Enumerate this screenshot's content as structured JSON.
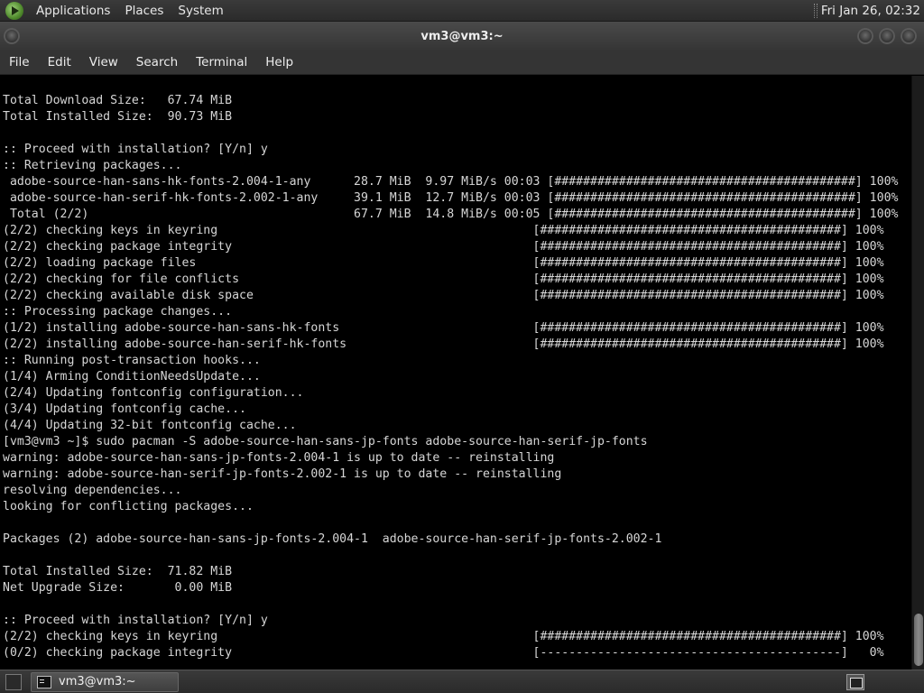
{
  "top_panel": {
    "menus": [
      "Applications",
      "Places",
      "System"
    ],
    "clock": "Fri Jan 26, 02:32"
  },
  "window": {
    "title": "vm3@vm3:~"
  },
  "menubar": {
    "items": [
      "File",
      "Edit",
      "View",
      "Search",
      "Terminal",
      "Help"
    ]
  },
  "terminal": {
    "lines": [
      "Total Download Size:   67.74 MiB",
      "Total Installed Size:  90.73 MiB",
      "",
      ":: Proceed with installation? [Y/n] y",
      ":: Retrieving packages...",
      " adobe-source-han-sans-hk-fonts-2.004-1-any      28.7 MiB  9.97 MiB/s 00:03 [##########################################] 100%",
      " adobe-source-han-serif-hk-fonts-2.002-1-any     39.1 MiB  12.7 MiB/s 00:03 [##########################################] 100%",
      " Total (2/2)                                     67.7 MiB  14.8 MiB/s 00:05 [##########################################] 100%",
      "(2/2) checking keys in keyring                                            [##########################################] 100%",
      "(2/2) checking package integrity                                          [##########################################] 100%",
      "(2/2) loading package files                                               [##########################################] 100%",
      "(2/2) checking for file conflicts                                         [##########################################] 100%",
      "(2/2) checking available disk space                                       [##########################################] 100%",
      ":: Processing package changes...",
      "(1/2) installing adobe-source-han-sans-hk-fonts                           [##########################################] 100%",
      "(2/2) installing adobe-source-han-serif-hk-fonts                          [##########################################] 100%",
      ":: Running post-transaction hooks...",
      "(1/4) Arming ConditionNeedsUpdate...",
      "(2/4) Updating fontconfig configuration...",
      "(3/4) Updating fontconfig cache...",
      "(4/4) Updating 32-bit fontconfig cache...",
      "[vm3@vm3 ~]$ sudo pacman -S adobe-source-han-sans-jp-fonts adobe-source-han-serif-jp-fonts",
      "warning: adobe-source-han-sans-jp-fonts-2.004-1 is up to date -- reinstalling",
      "warning: adobe-source-han-serif-jp-fonts-2.002-1 is up to date -- reinstalling",
      "resolving dependencies...",
      "looking for conflicting packages...",
      "",
      "Packages (2) adobe-source-han-sans-jp-fonts-2.004-1  adobe-source-han-serif-jp-fonts-2.002-1",
      "",
      "Total Installed Size:  71.82 MiB",
      "Net Upgrade Size:       0.00 MiB",
      "",
      ":: Proceed with installation? [Y/n] y",
      "(2/2) checking keys in keyring                                            [##########################################] 100%",
      "(0/2) checking package integrity                                          [------------------------------------------]   0%"
    ]
  },
  "taskbar": {
    "task_label": "vm3@vm3:~"
  }
}
